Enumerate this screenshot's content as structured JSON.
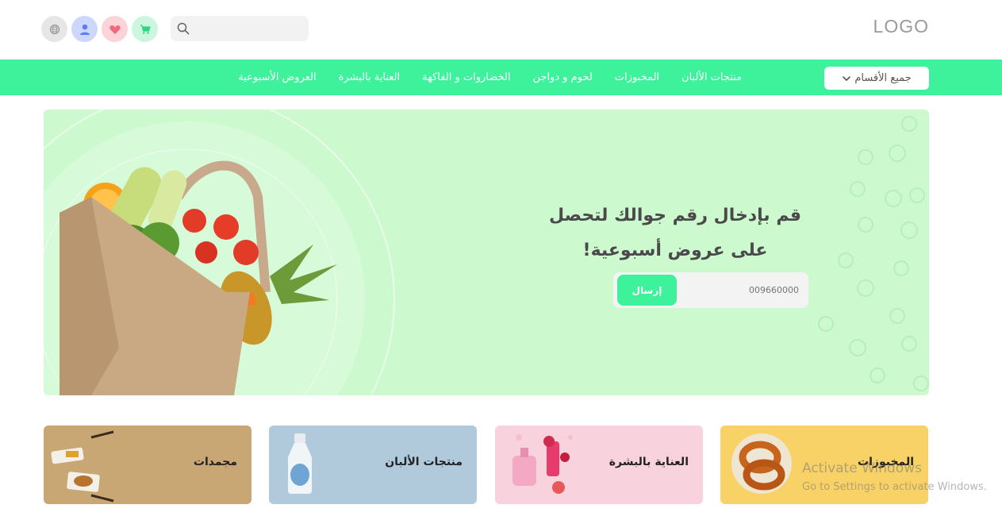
{
  "header": {
    "logo": "LOGO",
    "search": {
      "placeholder": ""
    },
    "icons": [
      "globe-icon",
      "user-icon",
      "heart-icon",
      "cart-icon"
    ]
  },
  "nav": {
    "all_categories": "جميع الأقسام",
    "links": [
      "منتجات الألبان",
      "المخبوزات",
      "لحوم و دواجن",
      "الخضاروات و الفاكهة",
      "العناية بالبشرة",
      "العروض الأسبوعية"
    ]
  },
  "hero": {
    "title_line1": "قم بإدخال رقم جوالك لتحصل",
    "title_line2": "على عروض أسبوعية!",
    "phone_placeholder": "009660000",
    "send_label": "إرسال"
  },
  "categories": [
    {
      "label": "المخبوزات"
    },
    {
      "label": "العناية بالبشرة"
    },
    {
      "label": "منتجات الألبان"
    },
    {
      "label": "مجمدات"
    }
  ],
  "watermark": {
    "line1": "Activate Windows",
    "line2": "Go to Settings to activate Windows."
  },
  "colors": {
    "accent": "#3ef29c",
    "hero_bg": "#cdf9cf",
    "card_bakery": "#f8d266",
    "card_skincare": "#f8d2dc",
    "card_dairy": "#b0c9db",
    "card_frozen": "#c8a774"
  }
}
